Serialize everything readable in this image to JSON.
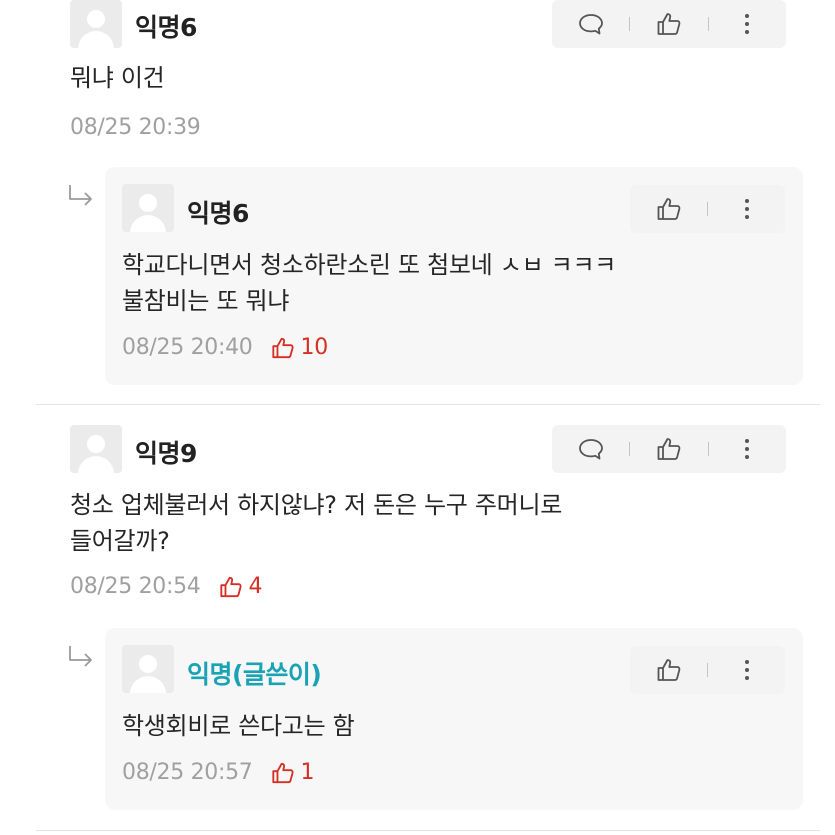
{
  "comments": [
    {
      "author": "익명6",
      "body": [
        "뭐냐 이건"
      ],
      "timestamp": "08/25 20:39",
      "likes": null,
      "reply": {
        "author": "익명6",
        "body": [
          "학교다니면서 청소하란소린 또 첨보네 ㅅㅂ ㅋㅋㅋ",
          "불참비는 또 뭐냐"
        ],
        "timestamp": "08/25 20:40",
        "likes": "10"
      }
    },
    {
      "author": "익명9",
      "body": [
        "청소 업체불러서 하지않냐? 저 돈은 누구 주머니로",
        "들어갈까?"
      ],
      "timestamp": "08/25 20:54",
      "likes": "4",
      "reply": {
        "author": "익명(글쓴이)",
        "body": [
          "학생회비로 쓴다고는 함"
        ],
        "timestamp": "08/25 20:57",
        "likes": "1"
      }
    }
  ],
  "icons": {
    "comment": "speech-bubble-icon",
    "like": "thumbs-up-icon",
    "more": "vertical-dots-icon",
    "reply": "reply-arrow-icon",
    "avatar": "default-avatar"
  },
  "colors": {
    "author_highlight": "#1aa3b5",
    "like_count": "#d62f24",
    "timestamp": "#a0a0a0",
    "action_bar_bg": "#f3f3f3",
    "reply_bg": "#f7f7f7"
  }
}
